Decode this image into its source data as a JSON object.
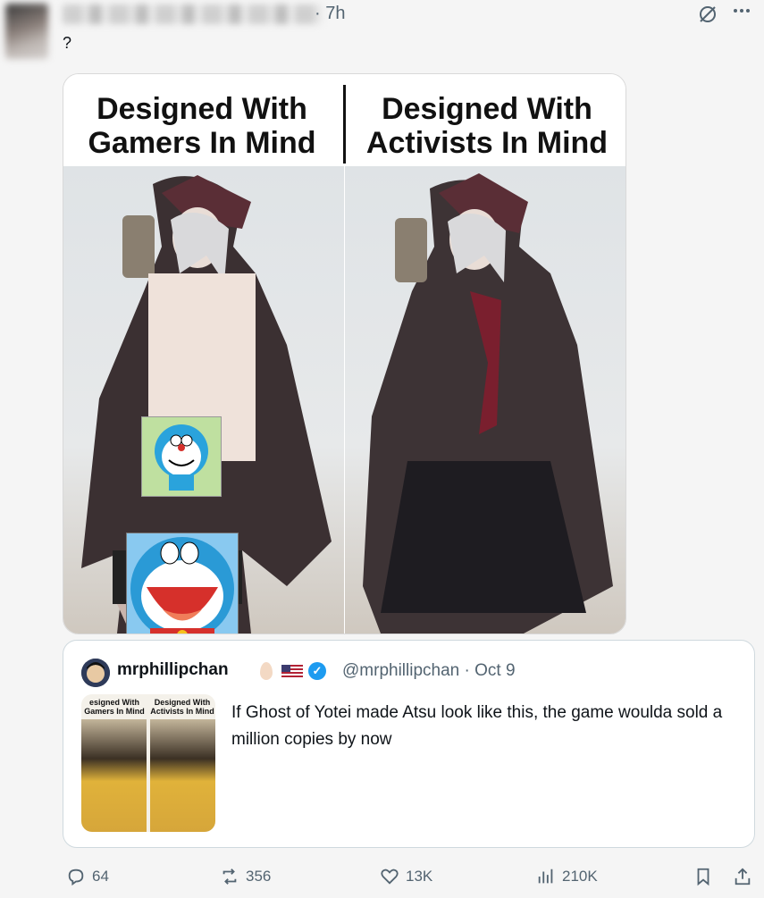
{
  "header": {
    "time": "· 7h",
    "more_icon": "more-icon",
    "grok_icon": "grok-icon"
  },
  "tweet": {
    "text": "?"
  },
  "meme": {
    "left_caption": "Designed With Gamers In Mind",
    "right_caption": "Designed With Activists In Mind"
  },
  "quote": {
    "name": "mrphillipchan",
    "handle_date": "@mrphillipchan · Oct 9",
    "text": "If Ghost of Yotei made Atsu look like this, the game woulda sold a million copies by now",
    "thumb_left_caption": "esigned With Gamers In Mind",
    "thumb_right_caption": "Designed With Activists In Mind"
  },
  "actions": {
    "replies": "64",
    "reposts": "356",
    "likes": "13K",
    "views": "210K"
  },
  "colors": {
    "muted": "#536471",
    "accent": "#1d9bf0"
  }
}
